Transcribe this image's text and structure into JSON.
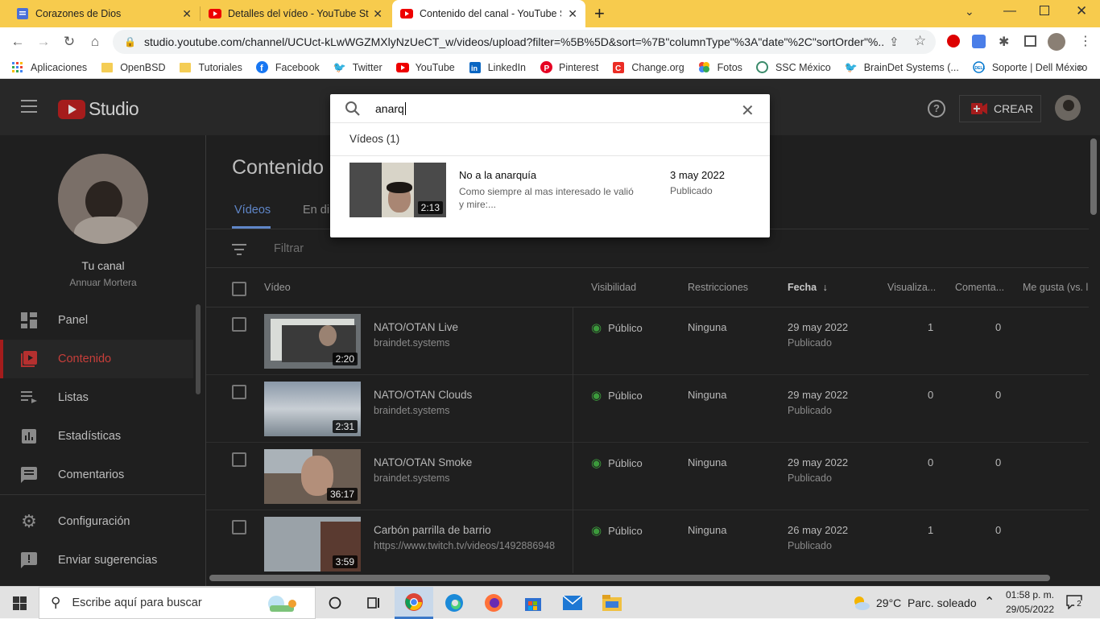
{
  "browser": {
    "tabs": [
      {
        "title": "Corazones de Dios",
        "favicon": "docs-icon",
        "active": false
      },
      {
        "title": "Detalles del vídeo - YouTube Studio",
        "favicon": "youtube-icon",
        "active": false
      },
      {
        "title": "Contenido del canal - YouTube Studio",
        "favicon": "youtube-icon",
        "active": true
      }
    ],
    "new_tab_label": "+",
    "url": "studio.youtube.com/channel/UCUct-kLwWGZMXlyNzUeCT_w/videos/upload?filter=%5B%5D&sort=%7B\"columnType\"%3A\"date\"%2C\"sortOrder\"%...",
    "bookmarks": [
      {
        "label": "Aplicaciones",
        "icon": "apps-grid-icon"
      },
      {
        "label": "OpenBSD",
        "icon": "folder-icon"
      },
      {
        "label": "Tutoriales",
        "icon": "folder-icon"
      },
      {
        "label": "Facebook",
        "icon": "facebook-icon"
      },
      {
        "label": "Twitter",
        "icon": "twitter-icon"
      },
      {
        "label": "YouTube",
        "icon": "youtube-icon"
      },
      {
        "label": "LinkedIn",
        "icon": "linkedin-icon"
      },
      {
        "label": "Pinterest",
        "icon": "pinterest-icon"
      },
      {
        "label": "Change.org",
        "icon": "change-icon"
      },
      {
        "label": "Fotos",
        "icon": "photos-icon"
      },
      {
        "label": "SSC México",
        "icon": "ssc-icon"
      },
      {
        "label": "BrainDet Systems (...",
        "icon": "twitter-icon"
      },
      {
        "label": "Soporte | Dell México",
        "icon": "dell-icon"
      }
    ],
    "more_label": "»"
  },
  "studio": {
    "logo_text": "Studio",
    "create_label": "CREAR",
    "channel_name": "Tu canal",
    "channel_owner": "Annuar Mortera",
    "sidebar": [
      {
        "label": "Panel",
        "icon": "dashboard-icon",
        "active": false
      },
      {
        "label": "Contenido",
        "icon": "content-icon",
        "active": true
      },
      {
        "label": "Listas",
        "icon": "playlists-icon",
        "active": false
      },
      {
        "label": "Estadísticas",
        "icon": "analytics-icon",
        "active": false
      },
      {
        "label": "Comentarios",
        "icon": "comments-icon",
        "active": false
      },
      {
        "label": "Configuración",
        "icon": "settings-icon",
        "active": false
      },
      {
        "label": "Enviar sugerencias",
        "icon": "feedback-icon",
        "active": false
      }
    ],
    "page_title": "Contenido d",
    "tabs": [
      "Vídeos",
      "En di"
    ],
    "filter_placeholder": "Filtrar",
    "columns": {
      "video": "Vídeo",
      "visibility": "Visibilidad",
      "restrictions": "Restricciones",
      "date": "Fecha",
      "views": "Visualiza...",
      "comments": "Comenta...",
      "likes": "Me gusta (vs. l"
    },
    "rows": [
      {
        "title": "NATO/OTAN Live",
        "desc": "braindet.systems",
        "duration": "2:20",
        "visibility": "Público",
        "restrictions": "Ninguna",
        "date": "29 may 2022",
        "status": "Publicado",
        "views": "1",
        "comments": "0"
      },
      {
        "title": "NATO/OTAN Clouds",
        "desc": "braindet.systems",
        "duration": "2:31",
        "visibility": "Público",
        "restrictions": "Ninguna",
        "date": "29 may 2022",
        "status": "Publicado",
        "views": "0",
        "comments": "0"
      },
      {
        "title": "NATO/OTAN Smoke",
        "desc": "braindet.systems",
        "duration": "36:17",
        "visibility": "Público",
        "restrictions": "Ninguna",
        "date": "29 may 2022",
        "status": "Publicado",
        "views": "0",
        "comments": "0"
      },
      {
        "title": "Carbón parrilla de barrio",
        "desc": "https://www.twitch.tv/videos/1492886948",
        "duration": "3:59",
        "visibility": "Público",
        "restrictions": "Ninguna",
        "date": "26 may 2022",
        "status": "Publicado",
        "views": "1",
        "comments": "0"
      }
    ]
  },
  "search": {
    "query": "anarq",
    "section_label": "Vídeos (1)",
    "result": {
      "title": "No a la anarquía",
      "desc_line1": "Como siempre al mas interesado le valió",
      "desc_line2": "y mire:...",
      "duration": "2:13",
      "date": "3 may 2022",
      "status": "Publicado"
    }
  },
  "taskbar": {
    "search_placeholder": "Escribe aquí para buscar",
    "weather_temp": "29°C",
    "weather_desc": "Parc. soleado",
    "time": "01:58 p. m.",
    "date": "29/05/2022",
    "notification_count": "2"
  }
}
